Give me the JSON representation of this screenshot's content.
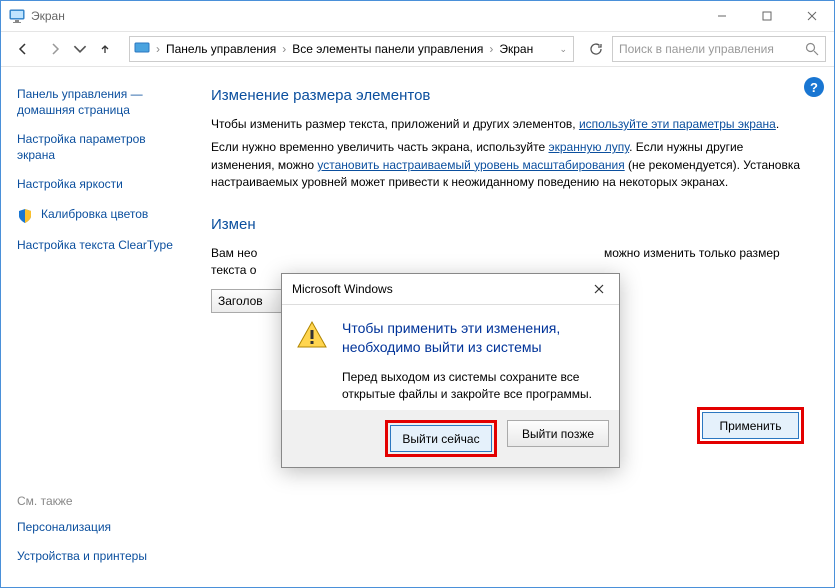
{
  "window": {
    "title": "Экран"
  },
  "nav": {
    "crumb1": "Панель управления",
    "crumb2": "Все элементы панели управления",
    "crumb3": "Экран",
    "search_placeholder": "Поиск в панели управления"
  },
  "sidebar": {
    "link_home": "Панель управления — домашняя страница",
    "link_params": "Настройка параметров экрана",
    "link_brightness": "Настройка яркости",
    "link_color": "Калибровка цветов",
    "link_cleartype": "Настройка текста ClearType",
    "see_also": "См. также",
    "link_personal": "Персонализация",
    "link_devices": "Устройства и принтеры"
  },
  "content": {
    "heading1": "Изменение размера элементов",
    "para1_pre": "Чтобы изменить размер текста, приложений и других элементов, ",
    "para1_link": "используйте эти параметры экрана",
    "para1_post": ".",
    "para2_pre": "Если нужно временно увеличить часть экрана, используйте ",
    "para2_link1": "экранную лупу",
    "para2_mid": ". Если нужны другие изменения, можно ",
    "para2_link2": "установить настраиваемый уровень масштабирования",
    "para2_post": " (не рекомендуется). Установка настраиваемых уровней может привести к неожиданному поведению на некоторых экранах.",
    "heading2": "Измен",
    "para3a": "Вам нео",
    "para3b": "можно изменить только размер",
    "para3c": "текста о",
    "combo_label": "Заголов",
    "apply": "Применить"
  },
  "dialog": {
    "title": "Microsoft Windows",
    "heading": "Чтобы применить эти изменения, необходимо выйти из системы",
    "body": "Перед выходом из системы сохраните все открытые файлы и закройте все программы.",
    "btn_now": "Выйти сейчас",
    "btn_later": "Выйти позже"
  }
}
